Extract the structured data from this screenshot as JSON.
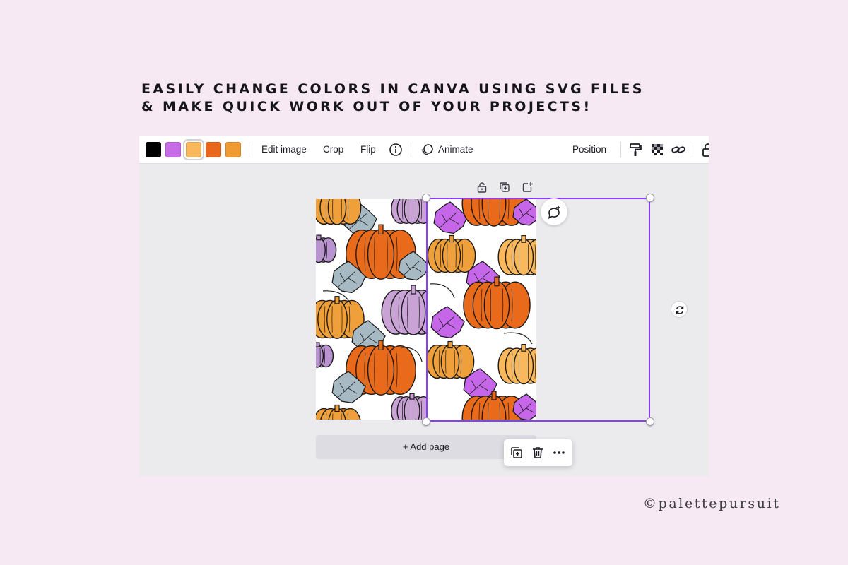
{
  "headline": {
    "line1": "EASILY CHANGE COLORS IN CANVA USING SVG FILES",
    "line2": "& MAKE QUICK WORK OUT OF YOUR PROJECTS!"
  },
  "toolbar": {
    "swatches": [
      {
        "color": "#000000",
        "selected": false
      },
      {
        "color": "#c86be6",
        "selected": false
      },
      {
        "color": "#f9b85c",
        "selected": true
      },
      {
        "color": "#e8671a",
        "selected": false
      },
      {
        "color": "#ef9a33",
        "selected": false
      }
    ],
    "edit_image_label": "Edit image",
    "crop_label": "Crop",
    "flip_label": "Flip",
    "animate_label": "Animate",
    "position_label": "Position",
    "icons": [
      "info-icon",
      "animate-icon",
      "paint-roller-icon",
      "transparency-icon",
      "link-icon",
      "lock-icon"
    ]
  },
  "canvas": {
    "floating_icons": [
      "lock-icon",
      "duplicate-icon",
      "add-icon"
    ],
    "pattern_left": {
      "pumpkin_colors": [
        "#e86a1a",
        "#f0a03a",
        "#c9a3d6",
        "#b893d0"
      ],
      "leaf_color": "#a7bac4"
    },
    "pattern_right": {
      "pumpkin_colors": [
        "#e86a1a",
        "#f0a03a",
        "#f9b85c"
      ],
      "leaf_color": "#c667ea"
    },
    "add_page_label": "+ Add page",
    "context_icons": [
      "duplicate-icon",
      "trash-icon",
      "more-icon"
    ]
  },
  "brand": {
    "text": "©palettepursuit"
  },
  "colors": {
    "background": "#f7e9f3",
    "selection": "#8b3dff"
  }
}
